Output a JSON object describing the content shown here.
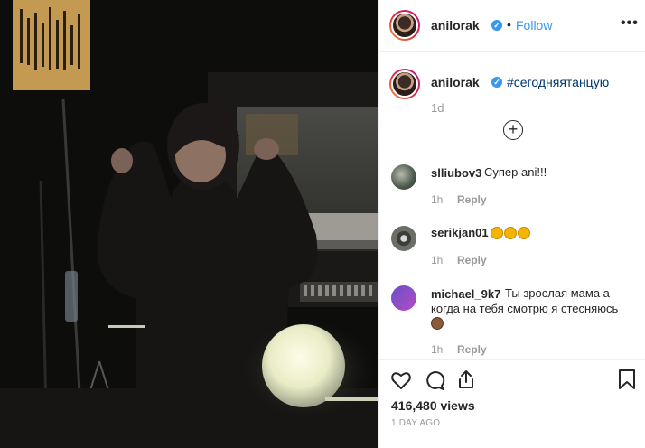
{
  "post": {
    "author": "anilorak",
    "follow_label": "Follow",
    "separator": "•",
    "more_label": "•••"
  },
  "caption": {
    "author": "anilorak",
    "text": "#сегодняятанцую",
    "time": "1d"
  },
  "comments": [
    {
      "user": "slliubov3",
      "text": "Супер ani!!!",
      "time": "1h",
      "reply": "Reply"
    },
    {
      "user": "serikjan01",
      "text": "",
      "time": "1h",
      "reply": "Reply"
    },
    {
      "user": "michael_9k7",
      "text_line1": "Ты зрослая мама а",
      "text_line2": "когда на тебя смотрю я стесняюсь",
      "time": "1h",
      "reply": "Reply"
    }
  ],
  "stats": {
    "views": "416,480 views",
    "time_ago": "1 DAY AGO"
  },
  "colors": {
    "link": "#3897f0",
    "hashtag": "#003569",
    "muted": "#999999"
  },
  "icons": [
    "heart-icon",
    "comment-icon",
    "share-icon",
    "bookmark-icon",
    "verified-icon",
    "load-more-icon"
  ]
}
